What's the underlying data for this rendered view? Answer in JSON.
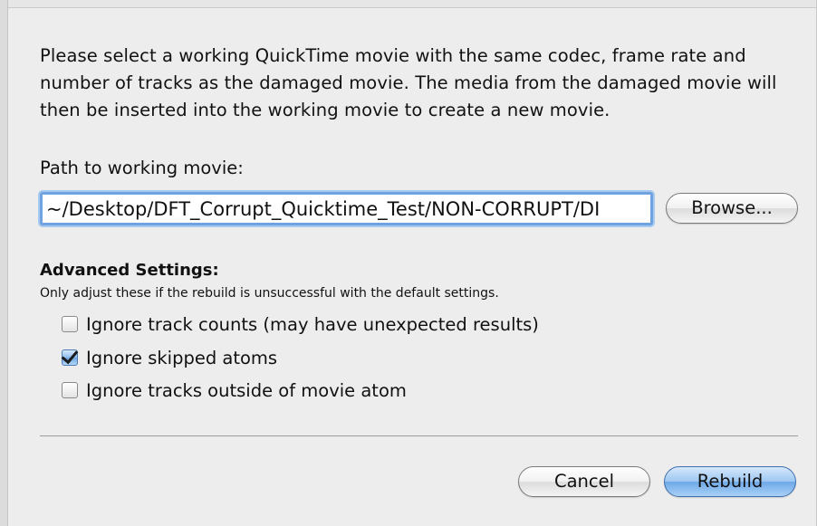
{
  "dialog": {
    "intro": "Please select a working QuickTime movie with the same codec, frame rate and number of tracks as the damaged movie. The media from the damaged movie will then be inserted into the working movie to create a new movie.",
    "path_label": "Path to working movie:",
    "path_value": "~/Desktop/DFT_Corrupt_Quicktime_Test/NON-CORRUPT/DI",
    "browse_label": "Browse...",
    "advanced": {
      "title": "Advanced Settings:",
      "note": "Only adjust these if the rebuild is unsuccessful with the default settings.",
      "options": [
        {
          "label": "Ignore track counts (may have unexpected results)",
          "checked": false
        },
        {
          "label": "Ignore skipped atoms",
          "checked": true
        },
        {
          "label": "Ignore tracks outside of movie atom",
          "checked": false
        }
      ]
    },
    "cancel_label": "Cancel",
    "rebuild_label": "Rebuild"
  },
  "colors": {
    "background": "#ededed",
    "focus_ring": "#6ea3df",
    "default_button": "#6ea8e6"
  }
}
